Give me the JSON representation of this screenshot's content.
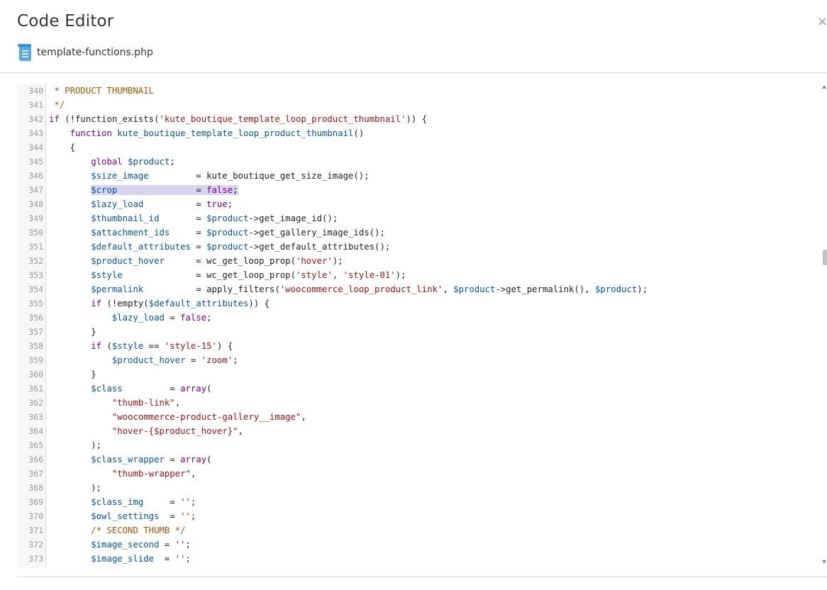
{
  "window": {
    "title": "Code Editor",
    "close_glyph": "×"
  },
  "file": {
    "name": "template-functions.php",
    "icon": "file-document-icon"
  },
  "colors": {
    "variable": "#0055aa",
    "keyword": "#770088",
    "string": "#aa1111",
    "comment": "#aa5500",
    "line_number": "#999999",
    "highlight": "#d7d4f0"
  },
  "editor": {
    "highlighted_line": 347,
    "lines": [
      {
        "n": "340",
        "tokens": [
          [
            "com",
            " * PRODUCT THUMBNAIL"
          ]
        ]
      },
      {
        "n": "341",
        "tokens": [
          [
            "com",
            " */"
          ]
        ]
      },
      {
        "n": "342",
        "tokens": [
          [
            "kw",
            "if"
          ],
          [
            "plain",
            " (!function_exists("
          ],
          [
            "str",
            "'kute_boutique_template_loop_product_thumbnail'"
          ],
          [
            "plain",
            ")) {"
          ]
        ]
      },
      {
        "n": "343",
        "tokens": [
          [
            "plain",
            "    "
          ],
          [
            "kw",
            "function"
          ],
          [
            "plain",
            " "
          ],
          [
            "var",
            "kute_boutique_template_loop_product_thumbnail"
          ],
          [
            "plain",
            "()"
          ]
        ]
      },
      {
        "n": "344",
        "tokens": [
          [
            "plain",
            "    {"
          ]
        ]
      },
      {
        "n": "345",
        "tokens": [
          [
            "plain",
            "        "
          ],
          [
            "kw",
            "global"
          ],
          [
            "plain",
            " "
          ],
          [
            "var",
            "$product"
          ],
          [
            "plain",
            ";"
          ]
        ]
      },
      {
        "n": "346",
        "tokens": [
          [
            "plain",
            "        "
          ],
          [
            "var",
            "$size_image"
          ],
          [
            "plain",
            "         = kute_boutique_get_size_image();"
          ]
        ]
      },
      {
        "n": "347",
        "tokens": [
          [
            "plain",
            "        "
          ],
          [
            "var",
            "$crop"
          ],
          [
            "plain",
            "               = "
          ],
          [
            "kw",
            "false"
          ],
          [
            "plain",
            ";"
          ]
        ]
      },
      {
        "n": "348",
        "tokens": [
          [
            "plain",
            "        "
          ],
          [
            "var",
            "$lazy_load"
          ],
          [
            "plain",
            "          = "
          ],
          [
            "kw",
            "true"
          ],
          [
            "plain",
            ";"
          ]
        ]
      },
      {
        "n": "349",
        "tokens": [
          [
            "plain",
            "        "
          ],
          [
            "var",
            "$thumbnail_id"
          ],
          [
            "plain",
            "       = "
          ],
          [
            "var",
            "$product"
          ],
          [
            "plain",
            "->get_image_id();"
          ]
        ]
      },
      {
        "n": "350",
        "tokens": [
          [
            "plain",
            "        "
          ],
          [
            "var",
            "$attachment_ids"
          ],
          [
            "plain",
            "     = "
          ],
          [
            "var",
            "$product"
          ],
          [
            "plain",
            "->get_gallery_image_ids();"
          ]
        ]
      },
      {
        "n": "351",
        "tokens": [
          [
            "plain",
            "        "
          ],
          [
            "var",
            "$default_attributes"
          ],
          [
            "plain",
            " = "
          ],
          [
            "var",
            "$product"
          ],
          [
            "plain",
            "->get_default_attributes();"
          ]
        ]
      },
      {
        "n": "352",
        "tokens": [
          [
            "plain",
            "        "
          ],
          [
            "var",
            "$product_hover"
          ],
          [
            "plain",
            "      = wc_get_loop_prop("
          ],
          [
            "str",
            "'hover'"
          ],
          [
            "plain",
            ");"
          ]
        ]
      },
      {
        "n": "353",
        "tokens": [
          [
            "plain",
            "        "
          ],
          [
            "var",
            "$style"
          ],
          [
            "plain",
            "              = wc_get_loop_prop("
          ],
          [
            "str",
            "'style'"
          ],
          [
            "plain",
            ", "
          ],
          [
            "str",
            "'style-01'"
          ],
          [
            "plain",
            ");"
          ]
        ]
      },
      {
        "n": "354",
        "tokens": [
          [
            "plain",
            "        "
          ],
          [
            "var",
            "$permalink"
          ],
          [
            "plain",
            "          = apply_filters("
          ],
          [
            "str",
            "'woocommerce_loop_product_link'"
          ],
          [
            "plain",
            ", "
          ],
          [
            "var",
            "$product"
          ],
          [
            "plain",
            "->get_permalink(), "
          ],
          [
            "var",
            "$product"
          ],
          [
            "plain",
            ");"
          ]
        ]
      },
      {
        "n": "355",
        "tokens": [
          [
            "plain",
            "        "
          ],
          [
            "kw",
            "if"
          ],
          [
            "plain",
            " (!empty("
          ],
          [
            "var",
            "$default_attributes"
          ],
          [
            "plain",
            ")) {"
          ]
        ]
      },
      {
        "n": "356",
        "tokens": [
          [
            "plain",
            "            "
          ],
          [
            "var",
            "$lazy_load"
          ],
          [
            "plain",
            " = "
          ],
          [
            "kw",
            "false"
          ],
          [
            "plain",
            ";"
          ]
        ]
      },
      {
        "n": "357",
        "tokens": [
          [
            "plain",
            "        }"
          ]
        ]
      },
      {
        "n": "358",
        "tokens": [
          [
            "plain",
            "        "
          ],
          [
            "kw",
            "if"
          ],
          [
            "plain",
            " ("
          ],
          [
            "var",
            "$style"
          ],
          [
            "plain",
            " == "
          ],
          [
            "str",
            "'style-15'"
          ],
          [
            "plain",
            ") {"
          ]
        ]
      },
      {
        "n": "359",
        "tokens": [
          [
            "plain",
            "            "
          ],
          [
            "var",
            "$product_hover"
          ],
          [
            "plain",
            " = "
          ],
          [
            "str",
            "'zoom'"
          ],
          [
            "plain",
            ";"
          ]
        ]
      },
      {
        "n": "360",
        "tokens": [
          [
            "plain",
            "        }"
          ]
        ]
      },
      {
        "n": "361",
        "tokens": [
          [
            "plain",
            "        "
          ],
          [
            "var",
            "$class"
          ],
          [
            "plain",
            "         = "
          ],
          [
            "kw",
            "array"
          ],
          [
            "plain",
            "("
          ]
        ]
      },
      {
        "n": "362",
        "tokens": [
          [
            "plain",
            "            "
          ],
          [
            "str",
            "\"thumb-link\""
          ],
          [
            "plain",
            ","
          ]
        ]
      },
      {
        "n": "363",
        "tokens": [
          [
            "plain",
            "            "
          ],
          [
            "str",
            "\"woocommerce-product-gallery__image\""
          ],
          [
            "plain",
            ","
          ]
        ]
      },
      {
        "n": "364",
        "tokens": [
          [
            "plain",
            "            "
          ],
          [
            "str",
            "\"hover-{$product_hover}\""
          ],
          [
            "plain",
            ","
          ]
        ]
      },
      {
        "n": "365",
        "tokens": [
          [
            "plain",
            "        );"
          ]
        ]
      },
      {
        "n": "366",
        "tokens": [
          [
            "plain",
            "        "
          ],
          [
            "var",
            "$class_wrapper"
          ],
          [
            "plain",
            " = "
          ],
          [
            "kw",
            "array"
          ],
          [
            "plain",
            "("
          ]
        ]
      },
      {
        "n": "367",
        "tokens": [
          [
            "plain",
            "            "
          ],
          [
            "str",
            "\"thumb-wrapper\""
          ],
          [
            "plain",
            ","
          ]
        ]
      },
      {
        "n": "368",
        "tokens": [
          [
            "plain",
            "        );"
          ]
        ]
      },
      {
        "n": "369",
        "tokens": [
          [
            "plain",
            "        "
          ],
          [
            "var",
            "$class_img"
          ],
          [
            "plain",
            "     = "
          ],
          [
            "str",
            "''"
          ],
          [
            "plain",
            ";"
          ]
        ]
      },
      {
        "n": "370",
        "tokens": [
          [
            "plain",
            "        "
          ],
          [
            "var",
            "$owl_settings"
          ],
          [
            "plain",
            "  = "
          ],
          [
            "str",
            "''"
          ],
          [
            "plain",
            ";"
          ]
        ]
      },
      {
        "n": "371",
        "tokens": [
          [
            "plain",
            "        "
          ],
          [
            "com",
            "/* SECOND THUMB */"
          ]
        ]
      },
      {
        "n": "372",
        "tokens": [
          [
            "plain",
            "        "
          ],
          [
            "var",
            "$image_second"
          ],
          [
            "plain",
            " = "
          ],
          [
            "str",
            "''"
          ],
          [
            "plain",
            ";"
          ]
        ]
      },
      {
        "n": "373",
        "tokens": [
          [
            "plain",
            "        "
          ],
          [
            "var",
            "$image_slide"
          ],
          [
            "plain",
            "  = "
          ],
          [
            "str",
            "''"
          ],
          [
            "plain",
            ";"
          ]
        ]
      }
    ]
  }
}
